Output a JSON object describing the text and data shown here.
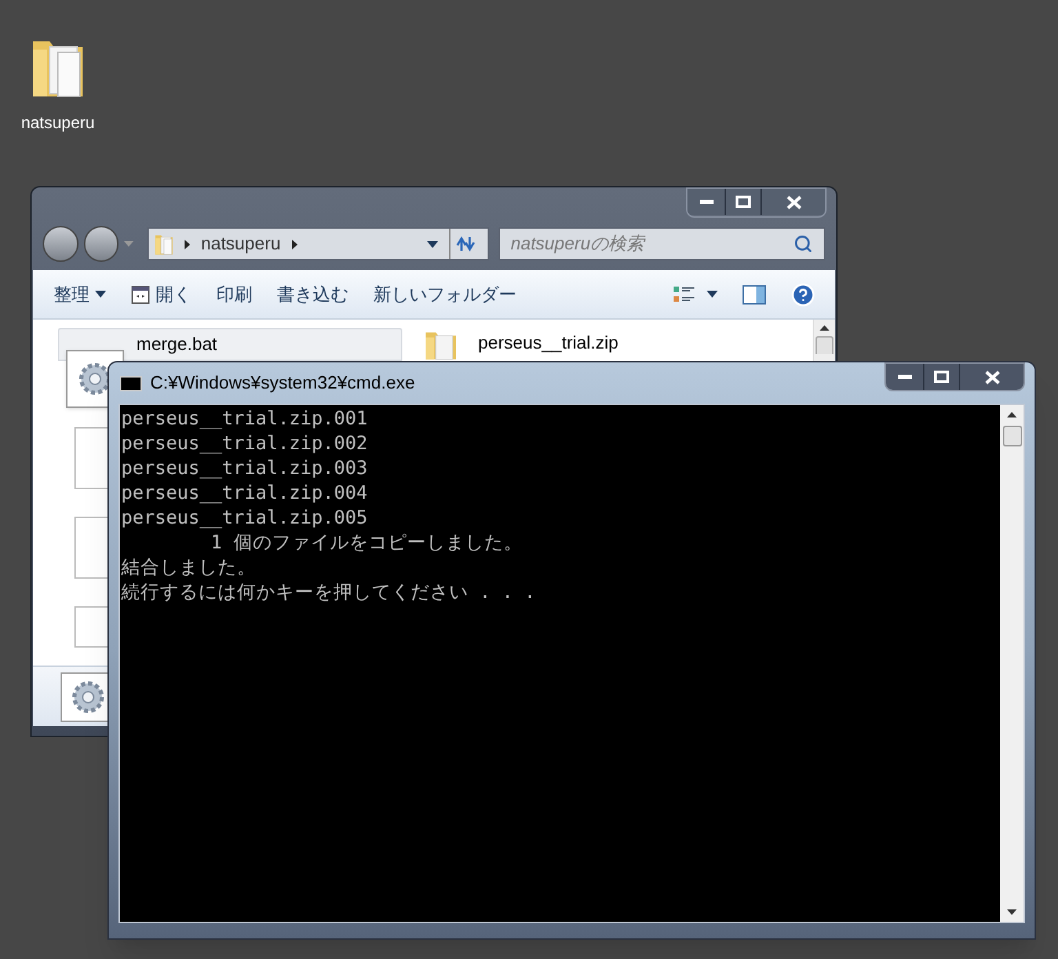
{
  "desktop_icons": [
    {
      "label": "natsuperu"
    }
  ],
  "explorer": {
    "address": [
      "natsuperu"
    ],
    "search": {
      "placeholder": "natsuperuの検索"
    },
    "toolbar": [
      {
        "label": "整理",
        "kind": "menu"
      },
      {
        "label": "開く",
        "kind": "icon"
      },
      {
        "label": "印刷",
        "kind": "text"
      },
      {
        "label": "書き込む",
        "kind": "text"
      },
      {
        "label": "新しいフォルダー",
        "kind": "text"
      }
    ],
    "files": [
      {
        "name": "merge.bat",
        "kind": "batch",
        "selected": true
      },
      {
        "name": "perseus__trial.zip",
        "kind": "zip",
        "selected": false
      }
    ]
  },
  "console": {
    "title": "C:¥Windows¥system32¥cmd.exe",
    "lines": [
      "perseus__trial.zip.001",
      "perseus__trial.zip.002",
      "perseus__trial.zip.003",
      "perseus__trial.zip.004",
      "perseus__trial.zip.005",
      "        1 個のファイルをコピーしました。",
      "結合しました。",
      "続行するには何かキーを押してください . . ."
    ]
  }
}
